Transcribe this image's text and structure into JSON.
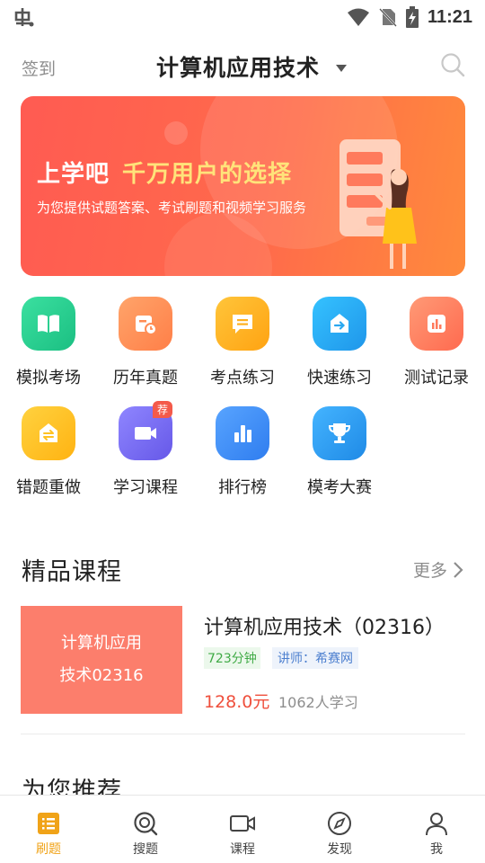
{
  "status": {
    "time": "11:21"
  },
  "header": {
    "checkin_label": "签到",
    "title": "计算机应用技术"
  },
  "banner": {
    "headline_left": "上学吧",
    "headline_right": "千万用户的选择",
    "subtitle": "为您提供试题答案、考试刷题和视频学习服务"
  },
  "features": [
    {
      "label": "模拟考场",
      "icon": "book-icon",
      "color": "#2bcf92"
    },
    {
      "label": "历年真题",
      "icon": "calendar-clock-icon",
      "color": "#ff8c54"
    },
    {
      "label": "考点练习",
      "icon": "message-list-icon",
      "color": "#ffb01f"
    },
    {
      "label": "快速练习",
      "icon": "box-arrow-icon",
      "color": "#2aa8f0"
    },
    {
      "label": "测试记录",
      "icon": "bar-chart-icon",
      "color": "#ff7a5c"
    },
    {
      "label": "错题重做",
      "icon": "swap-icon",
      "color": "#ffc222"
    },
    {
      "label": "学习课程",
      "icon": "video-icon",
      "color": "#7a6ff0",
      "badge": "荐"
    },
    {
      "label": "排行榜",
      "icon": "ranking-icon",
      "color": "#3f8df5"
    },
    {
      "label": "模考大赛",
      "icon": "trophy-icon",
      "color": "#2f9ef0"
    }
  ],
  "premium": {
    "title": "精品课程",
    "more_label": "更多",
    "course": {
      "thumb_line1": "计算机应用",
      "thumb_line2": "技术02316",
      "name": "计算机应用技术（02316）",
      "duration": "723分钟",
      "teacher": "讲师：希赛网",
      "price": "128.0元",
      "learners": "1062人学习"
    }
  },
  "recommend_title": "为您推荐",
  "nav": [
    {
      "label": "刷题",
      "icon": "list-icon",
      "active": true
    },
    {
      "label": "搜题",
      "icon": "search-question-icon",
      "active": false
    },
    {
      "label": "课程",
      "icon": "video-camera-icon",
      "active": false
    },
    {
      "label": "发现",
      "icon": "compass-icon",
      "active": false
    },
    {
      "label": "我",
      "icon": "user-icon",
      "active": false
    }
  ],
  "colors": {
    "accent": "#f0a318",
    "price": "#ef4f3c",
    "banner": "#ff5b52"
  }
}
